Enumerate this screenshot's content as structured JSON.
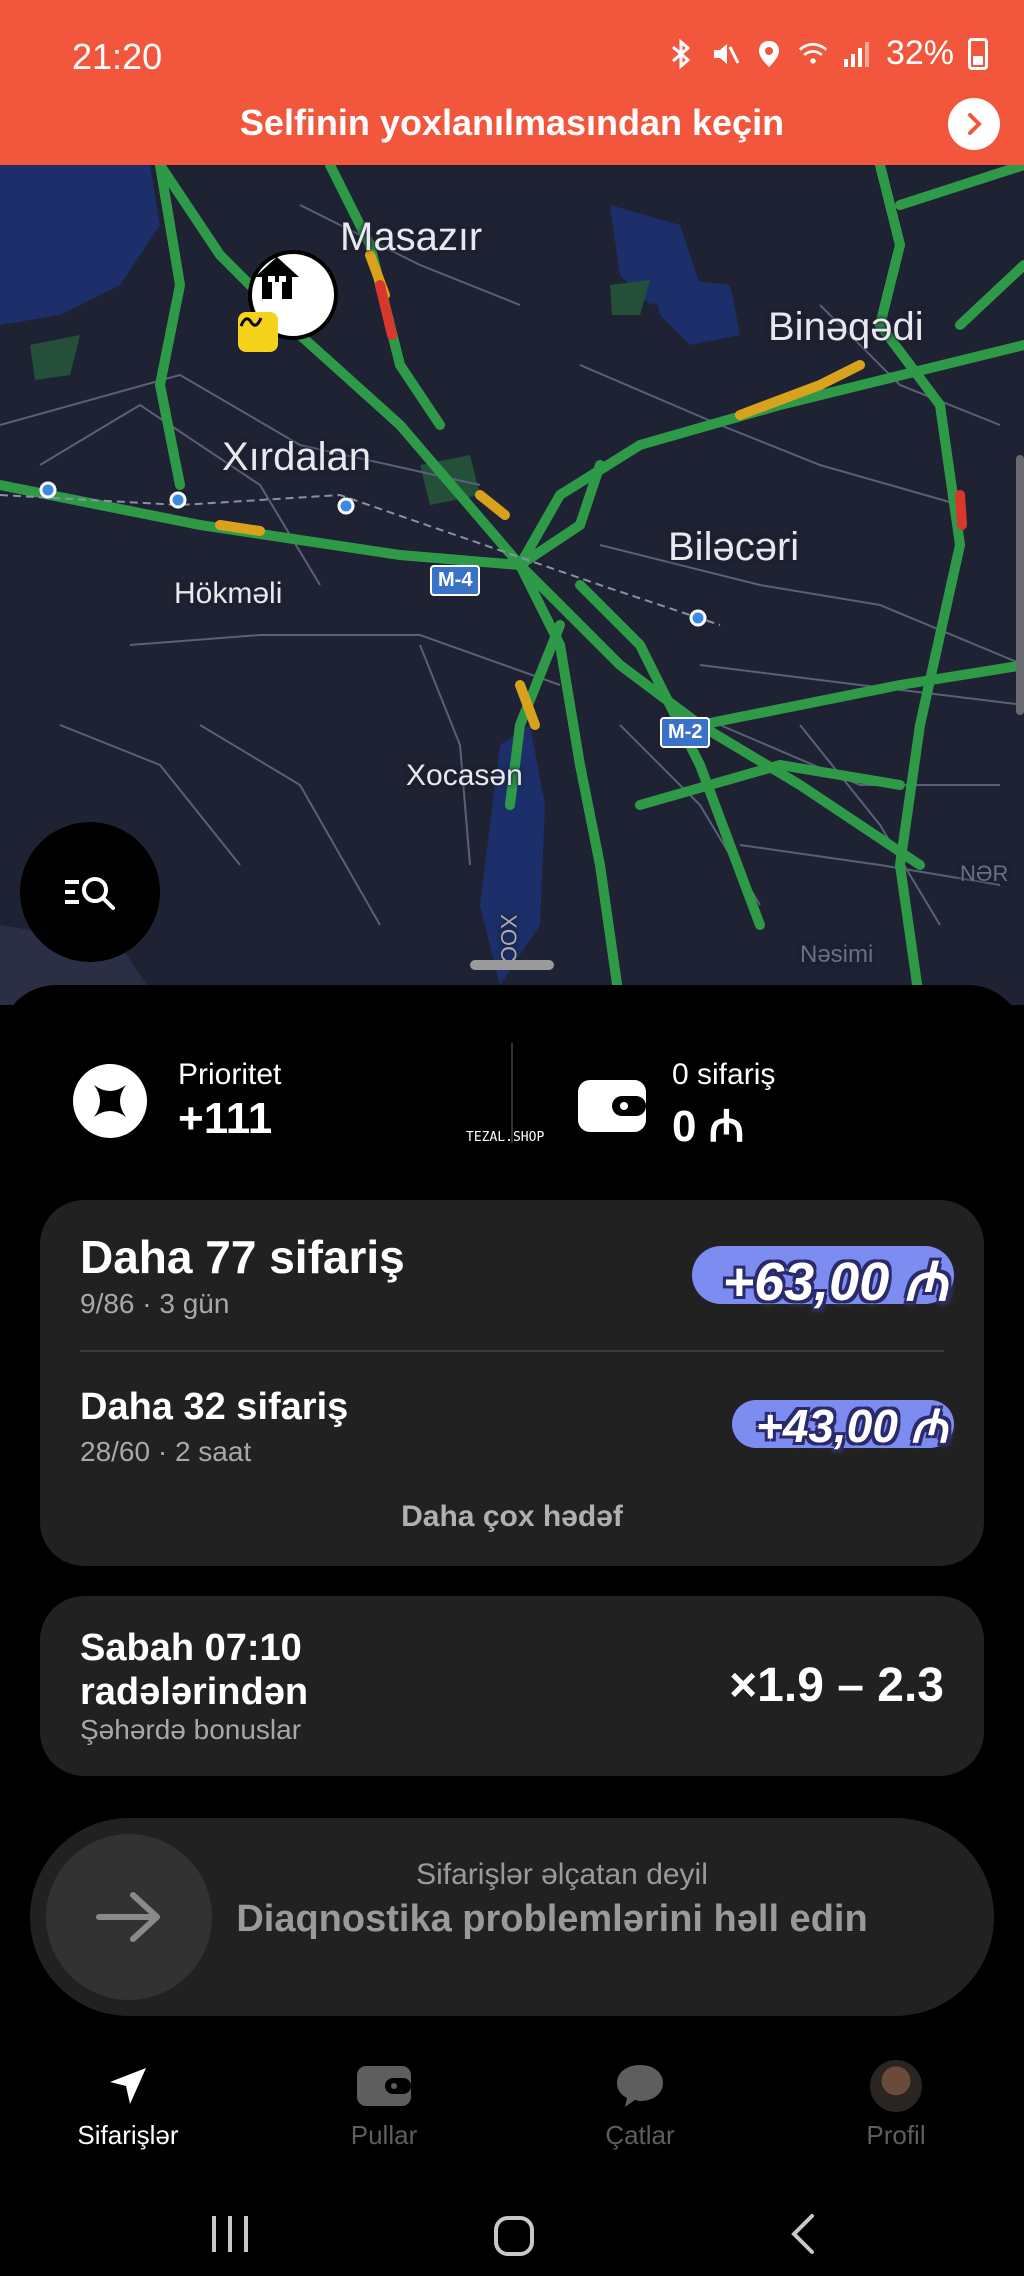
{
  "status_bar": {
    "time": "21:20",
    "battery": "32%"
  },
  "banner": {
    "text": "Selfinin yoxlanılmasından keçin"
  },
  "map": {
    "labels": {
      "masazir": "Masazır",
      "bineqedi": "Binəqədi",
      "xirdalan": "Xırdalan",
      "bilecari": "Biləcəri",
      "hokmeli": "Hökməli",
      "xocasen": "Xocasən",
      "nesimi": "Nəsimi",
      "ner": "NƏR",
      "xoc": "XOC"
    },
    "road_badges": {
      "m4": "M-4",
      "m2": "M-2"
    }
  },
  "stats": {
    "priority_label": "Prioritet",
    "priority_value": "+111",
    "orders_label": "0 sifariş",
    "orders_value": "0 ₼",
    "watermark": "TEZAL.SHOP"
  },
  "goals": {
    "goal1_title": "Daha 77 sifariş",
    "goal1_sub": "9/86 · 3 gün",
    "goal1_bonus": "+63,00 ₼",
    "goal2_title": "Daha 32 sifariş",
    "goal2_sub": "28/60 · 2 saat",
    "goal2_bonus": "+43,00 ₼",
    "more_label": "Daha çox hədəf"
  },
  "surge": {
    "title_line1": "Sabah 07:10",
    "title_line2": "radələrindən",
    "subtitle": "Şəhərdə bonuslar",
    "value": "×1.9 – 2.3"
  },
  "slider": {
    "subtitle": "Sifarişlər əlçatan deyil",
    "title": "Diaqnostika problemlərini həll edin"
  },
  "nav": {
    "orders": "Sifarişlər",
    "money": "Pullar",
    "chats": "Çatlar",
    "profile": "Profil"
  },
  "colors": {
    "banner": "#f2563c",
    "accent_bonus": "#7d8cf0",
    "road_green": "#2e9a48"
  }
}
